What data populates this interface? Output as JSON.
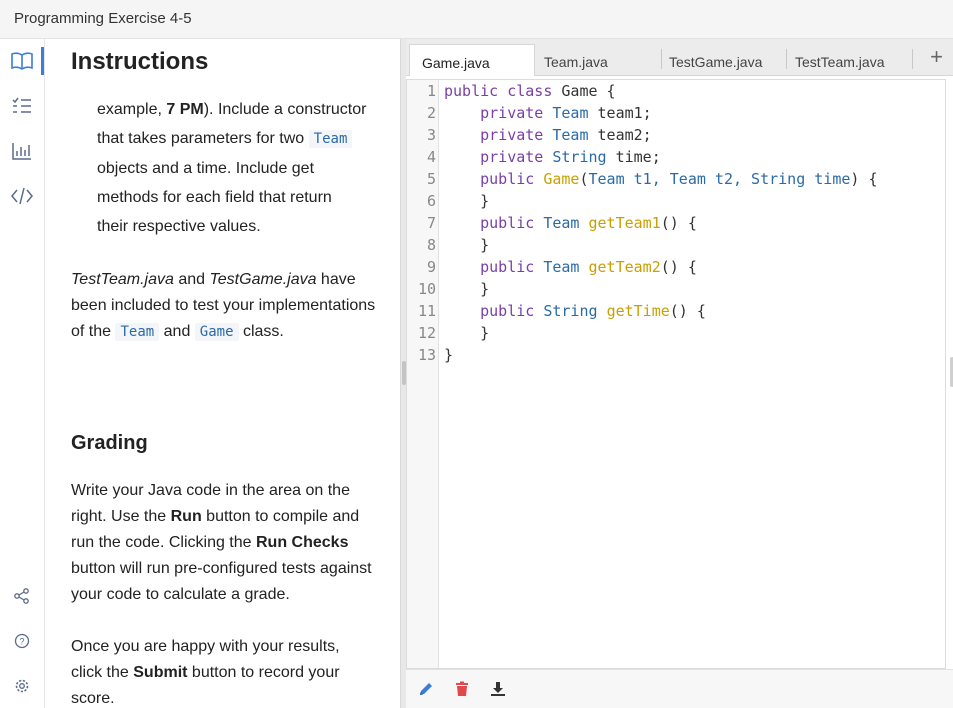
{
  "window": {
    "title": "Programming Exercise 4-5"
  },
  "icon_rail": {
    "top_icons": [
      "book-icon",
      "checklist-icon",
      "chart-icon",
      "code-icon"
    ],
    "bottom_icons": [
      "share-icon",
      "help-icon",
      "settings-icon"
    ],
    "active": "book-icon"
  },
  "instructions": {
    "heading": "Instructions",
    "bullet_cont": {
      "l1_pre": "example, ",
      "l1_bold": "7 PM",
      "l1_post": "). Include a constructor",
      "l2_pre": "that takes parameters for two ",
      "l2_code": "Team",
      "l3": "objects and a time. Include get",
      "l4": "methods for each field that return",
      "l5": "their respective values."
    },
    "para1": {
      "em1": "TestTeam.java",
      "t1": " and ",
      "em2": "TestGame.java",
      "t2": " have been included to test your implementations of the ",
      "code1": "Team",
      "t3": " and ",
      "code2": "Game",
      "t4": " class."
    },
    "grading_heading": "Grading",
    "para2": {
      "t1": "Write your Java code in the area on the right. Use the ",
      "b1": "Run",
      "t2": " button to compile and run the code. Clicking the ",
      "b2": "Run Checks",
      "t3": " button will run pre-configured tests against your code to calculate a grade."
    },
    "para3": {
      "t1": "Once you are happy with your results, click the ",
      "b1": "Submit",
      "t2": " button to record your score."
    }
  },
  "editor": {
    "tabs": [
      {
        "label": "Game.java",
        "active": true
      },
      {
        "label": "Team.java",
        "active": false
      },
      {
        "label": "TestGame.java",
        "active": false
      },
      {
        "label": "TestTeam.java",
        "active": false
      }
    ],
    "add_tab_label": "+",
    "line_numbers": [
      "1",
      "2",
      "3",
      "4",
      "5",
      "6",
      "7",
      "8",
      "9",
      "10",
      "11",
      "12",
      "13"
    ],
    "code": {
      "l1": {
        "kw1": "public",
        "kw2": "class",
        "rest": " Game {"
      },
      "l2": {
        "ind": "    ",
        "kw": "private",
        "ty": "Team",
        "rest": " team1;"
      },
      "l3": {
        "ind": "    ",
        "kw": "private",
        "ty": "Team",
        "rest": " team2;"
      },
      "l4": {
        "ind": "    ",
        "kw": "private",
        "ty": "String",
        "rest": " time;"
      },
      "l5": {
        "ind": "    ",
        "kw": "public",
        "fn": "Game",
        "open": "(",
        "params": "Team t1, Team t2, String time",
        "close": ") {"
      },
      "l6": {
        "text": "    }"
      },
      "l7": {
        "ind": "    ",
        "kw": "public",
        "ty": "Team",
        "fn": "getTeam1",
        "rest": "() {"
      },
      "l8": {
        "text": "    }"
      },
      "l9": {
        "ind": "    ",
        "kw": "public",
        "ty": "Team",
        "fn": "getTeam2",
        "rest": "() {"
      },
      "l10": {
        "text": "    }"
      },
      "l11": {
        "ind": "    ",
        "kw": "public",
        "ty": "String",
        "fn": "getTime",
        "rest": "() {"
      },
      "l12": {
        "text": "    }"
      },
      "l13": {
        "text": "}"
      }
    },
    "bottom_icons": [
      "pencil-icon",
      "trash-icon",
      "download-icon"
    ],
    "colors": {
      "keyword": "#7a3fa6",
      "type": "#2a6aa8",
      "function": "#c9a000",
      "pencil": "#3b7dd8",
      "trash": "#e04a4a"
    }
  }
}
